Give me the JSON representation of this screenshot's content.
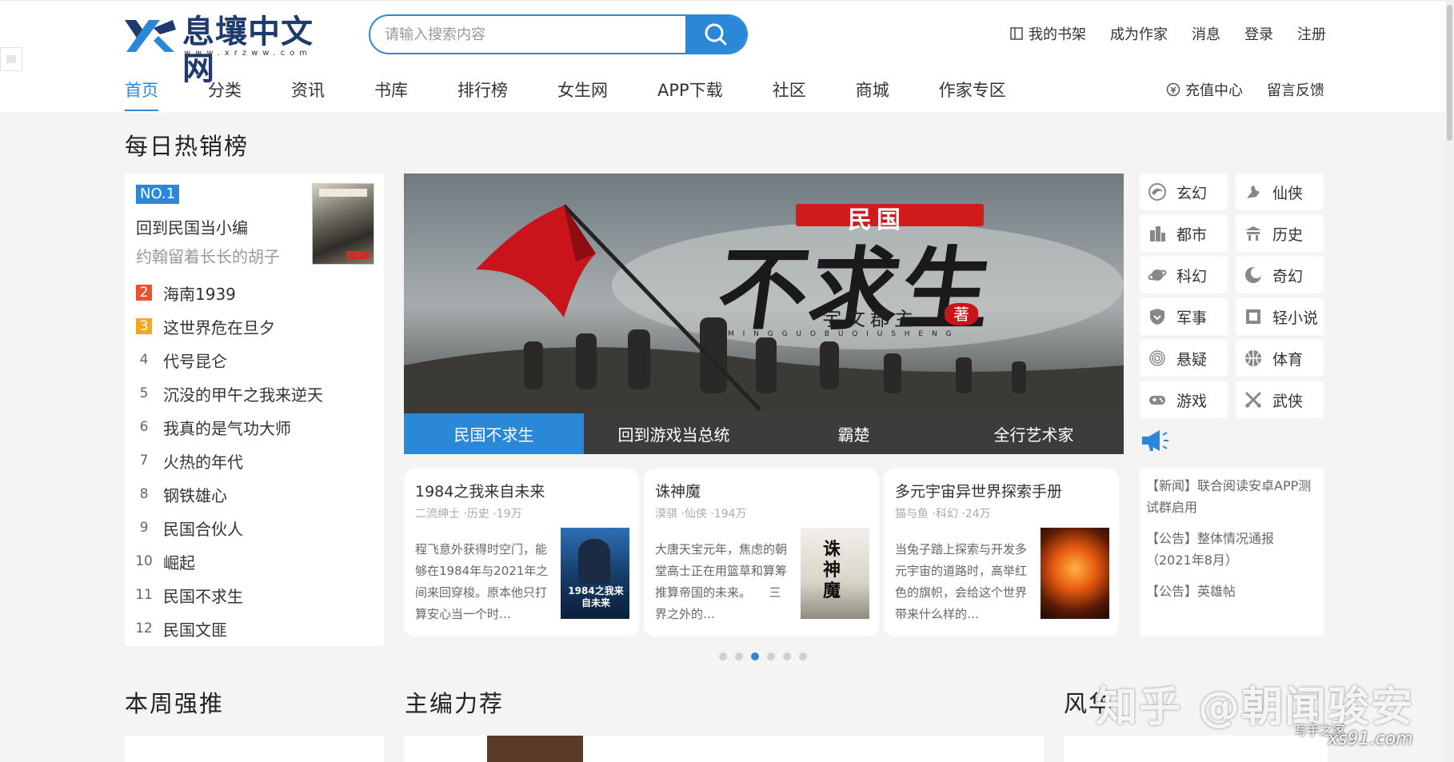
{
  "site": {
    "logo_text": "息壤中文网",
    "logo_url": "www.xrzww.com"
  },
  "search": {
    "placeholder": "请输入搜索内容"
  },
  "toplinks": {
    "shelf": "我的书架",
    "become_author": "成为作家",
    "messages": "消息",
    "login": "登录",
    "register": "注册"
  },
  "nav": {
    "items": [
      "首页",
      "分类",
      "资讯",
      "书库",
      "排行榜",
      "女生网",
      "APP下载",
      "社区",
      "商城",
      "作家专区"
    ],
    "recharge": "充值中心",
    "feedback": "留言反馈"
  },
  "daily": {
    "title": "每日热销榜",
    "no1_badge": "NO.1",
    "no1_title": "回到民国当小编",
    "no1_author": "约翰留着长长的胡子",
    "list": [
      {
        "rank": "2",
        "title": "海南1939"
      },
      {
        "rank": "3",
        "title": "这世界危在旦夕"
      },
      {
        "rank": "4",
        "title": "代号昆仑"
      },
      {
        "rank": "5",
        "title": "沉没的甲午之我来逆天"
      },
      {
        "rank": "6",
        "title": "我真的是气功大师"
      },
      {
        "rank": "7",
        "title": "火热的年代"
      },
      {
        "rank": "8",
        "title": "钢铁雄心"
      },
      {
        "rank": "9",
        "title": "民国合伙人"
      },
      {
        "rank": "10",
        "title": "崛起"
      },
      {
        "rank": "11",
        "title": "民国不求生"
      },
      {
        "rank": "12",
        "title": "民国文匪"
      }
    ]
  },
  "banner": {
    "art_small": "民国",
    "art_big": "不求生",
    "art_author": "宇文郡主",
    "art_seal": "著",
    "art_pinyin": "M I N G G U O B U Q I U S H E N G",
    "tabs": [
      "民国不求生",
      "回到游戏当总统",
      "霸楚",
      "全行艺术家"
    ]
  },
  "categories": [
    {
      "label": "玄幻",
      "icon": "swirl-icon"
    },
    {
      "label": "仙侠",
      "icon": "sword-hand-icon"
    },
    {
      "label": "都市",
      "icon": "city-icon"
    },
    {
      "label": "历史",
      "icon": "temple-icon"
    },
    {
      "label": "科幻",
      "icon": "planet-icon"
    },
    {
      "label": "奇幻",
      "icon": "moon-icon"
    },
    {
      "label": "军事",
      "icon": "shield-icon"
    },
    {
      "label": "轻小说",
      "icon": "book-icon"
    },
    {
      "label": "悬疑",
      "icon": "fingerprint-icon"
    },
    {
      "label": "体育",
      "icon": "ball-icon"
    },
    {
      "label": "游戏",
      "icon": "gamepad-icon"
    },
    {
      "label": "武侠",
      "icon": "crossed-swords-icon"
    }
  ],
  "books": [
    {
      "title": "1984之我来自未来",
      "meta": "二流绅士 ·历史 ·19万",
      "desc": "程飞意外获得时空门，能够在1984年与2021年之间来回穿梭。原本他只打算安心当一个时…",
      "cover_text": "1984之我来自未来"
    },
    {
      "title": "诛神魔",
      "meta": "漠骐 ·仙侠 ·194万",
      "desc": "大唐天宝元年，焦虑的朝堂高士正在用篮草和算筹推算帝国的未来。　　三界之外的…",
      "cover_text": "诛神魔"
    },
    {
      "title": "多元宇宙异世界探索手册",
      "meta": "猫与鱼 ·科幻 ·24万",
      "desc": "当兔子踏上探索与开发多元宇宙的道路时，高举红色的旗帜，会给这个世界带来什么样的…",
      "cover_text": ""
    }
  ],
  "dots": {
    "count": 6,
    "active": 2
  },
  "notices": [
    {
      "tag": "【新闻】",
      "text": "联合阅读安卓APP测试群启用"
    },
    {
      "tag": "【公告】",
      "text": "整体情况通报（2021年8月）"
    },
    {
      "tag": "【公告】",
      "text": "英雄帖"
    }
  ],
  "sections": {
    "weekly": "本周强推",
    "editor": "主编力荐",
    "style": "风华"
  },
  "watermark": {
    "zhihu": "知乎 @朝闻骏安",
    "site1": "写手之家",
    "site2": "xs91.com"
  },
  "colors": {
    "accent": "#2b88d9",
    "rank2": "#e8532d",
    "rank3": "#f5a623"
  }
}
